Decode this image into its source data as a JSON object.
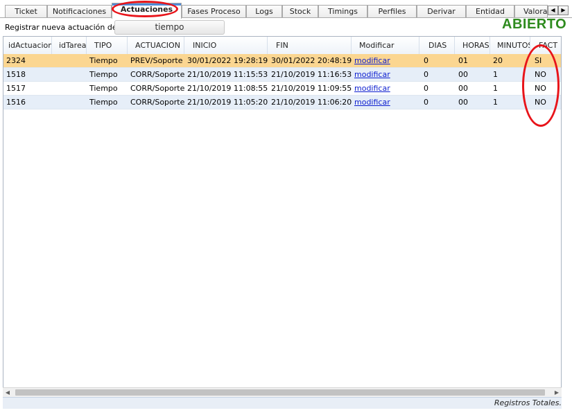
{
  "tabs": [
    {
      "label": "Ticket",
      "active": false
    },
    {
      "label": "Notificaciones",
      "active": false
    },
    {
      "label": "Actuaciones",
      "active": true
    },
    {
      "label": "Fases Proceso",
      "active": false
    },
    {
      "label": "Logs",
      "active": false
    },
    {
      "label": "Stock",
      "active": false
    },
    {
      "label": "Timings",
      "active": false
    },
    {
      "label": "Perfiles",
      "active": false
    },
    {
      "label": "Derivar",
      "active": false
    },
    {
      "label": "Entidad",
      "active": false
    },
    {
      "label": "Valoraci",
      "active": false
    }
  ],
  "tab_scroll": {
    "left_icon": "◀",
    "right_icon": "▶"
  },
  "register": {
    "label": "Registrar nueva actuación de:",
    "button_label": "tiempo"
  },
  "status": {
    "label": "ABIERTO",
    "color": "#2e8b1e"
  },
  "annotation_color": "#e8141a",
  "grid": {
    "columns": [
      "idActuacion",
      "idTarea",
      "TIPO",
      "ACTUACION",
      "INICIO",
      "FIN",
      "Modificar",
      "DIAS",
      "HORAS",
      "MINUTOS",
      "FACT"
    ],
    "rows": [
      {
        "idActuacion": "2324",
        "idTarea": "",
        "TIPO": "Tiempo",
        "ACTUACION": "PREV/Soporte",
        "INICIO": "30/01/2022 19:28:19",
        "FIN": "30/01/2022 20:48:19",
        "Modificar": "modificar",
        "DIAS": "0",
        "HORAS": "01",
        "MINUTOS": "20",
        "FACT": "SI",
        "selected": true
      },
      {
        "idActuacion": "1518",
        "idTarea": "",
        "TIPO": "Tiempo",
        "ACTUACION": "CORR/Soporte",
        "INICIO": "21/10/2019 11:15:53",
        "FIN": "21/10/2019 11:16:53",
        "Modificar": "modificar",
        "DIAS": "0",
        "HORAS": "00",
        "MINUTOS": "1",
        "FACT": "NO",
        "selected": false
      },
      {
        "idActuacion": "1517",
        "idTarea": "",
        "TIPO": "Tiempo",
        "ACTUACION": "CORR/Soporte",
        "INICIO": "21/10/2019 11:08:55",
        "FIN": "21/10/2019 11:09:55",
        "Modificar": "modificar",
        "DIAS": "0",
        "HORAS": "00",
        "MINUTOS": "1",
        "FACT": "NO",
        "selected": false
      },
      {
        "idActuacion": "1516",
        "idTarea": "",
        "TIPO": "Tiempo",
        "ACTUACION": "CORR/Soporte",
        "INICIO": "21/10/2019 11:05:20",
        "FIN": "21/10/2019 11:06:20",
        "Modificar": "modificar",
        "DIAS": "0",
        "HORAS": "00",
        "MINUTOS": "1",
        "FACT": "NO",
        "selected": false
      }
    ]
  },
  "scrollbar": {
    "left_icon": "◀",
    "right_icon": "▶"
  },
  "footer": {
    "text": "Registros Totales."
  }
}
